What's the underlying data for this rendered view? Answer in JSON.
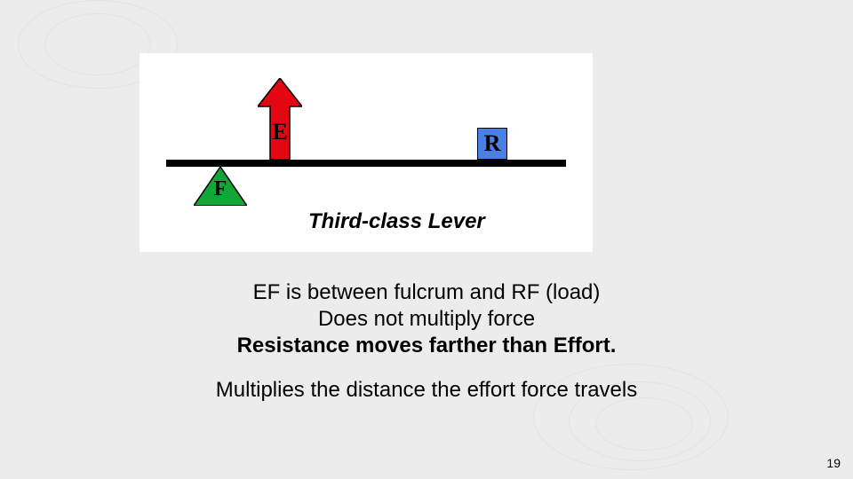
{
  "diagram": {
    "effort_label": "E",
    "resistance_label": "R",
    "fulcrum_label": "F",
    "title": "Third-class Lever"
  },
  "text": {
    "line1": "EF is between fulcrum and RF (load)",
    "line2": "Does not multiply force",
    "line3": "Resistance moves farther than Effort.",
    "line4": "Multiplies the distance the effort force travels"
  },
  "page_number": "19"
}
